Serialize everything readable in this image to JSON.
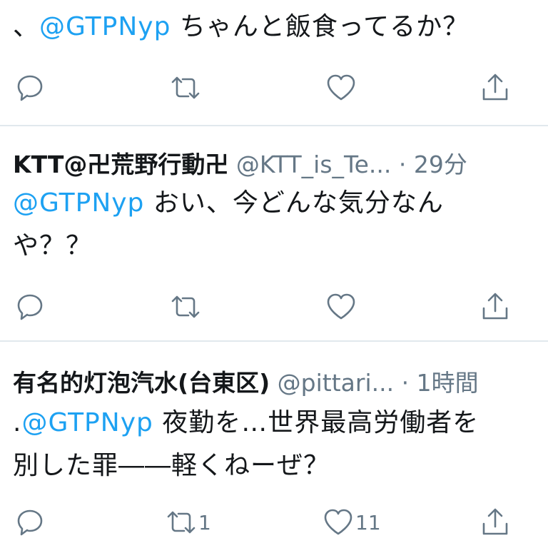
{
  "tweets": [
    {
      "mention": "@GTPNyp",
      "prefix": "、",
      "body": " ちゃんと飯食ってるか？"
    },
    {
      "name": "KTT@卍荒野行動卍",
      "handle": "@KTT_is_Te...",
      "time": "· 29分",
      "mention": "@GTPNyp",
      "body_line1": " おい、今どんな気分なん",
      "body_line2": "や？？"
    },
    {
      "name": "有名的灯泡汽水(台東区)",
      "handle": "@pittari...",
      "time": "· 1時間",
      "prefix": ".",
      "mention": "@GTPNyp",
      "body_line1": " 夜勤を…世界最高労働者を",
      "body_line2": "別した罪――軽くねーぜ？",
      "retweet_count": "1",
      "like_count": "11"
    }
  ],
  "icons": [
    "reply-icon",
    "retweet-icon",
    "like-icon",
    "share-icon"
  ],
  "colors": {
    "mention": "#1da1f2",
    "muted": "#657786",
    "divider": "#e1e8ed"
  }
}
